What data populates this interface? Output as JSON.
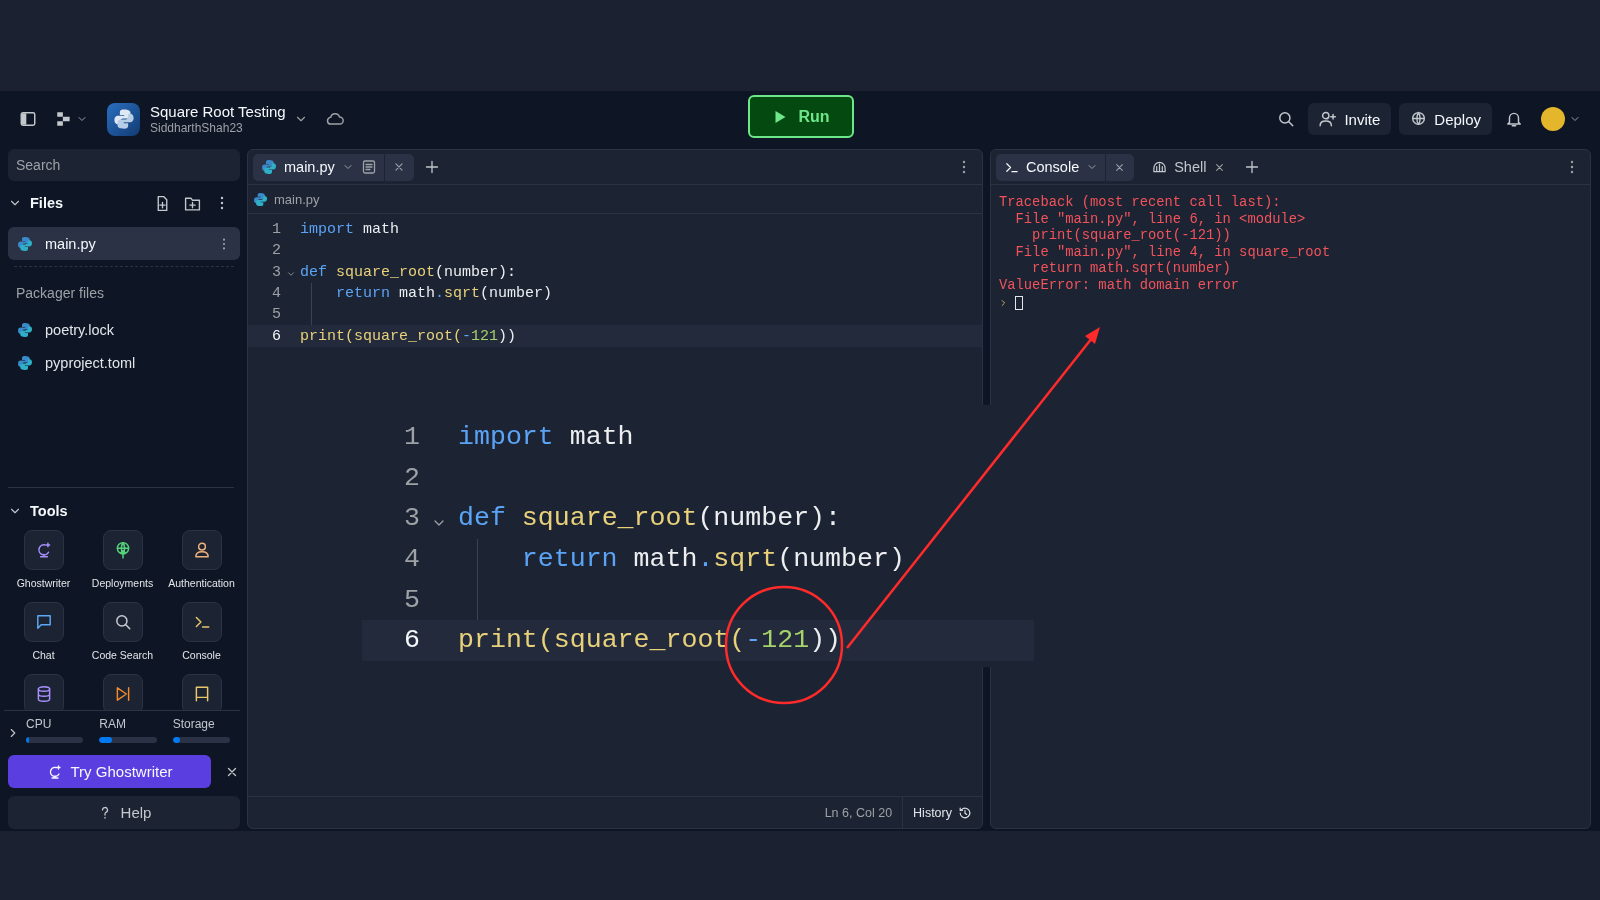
{
  "header": {
    "project_title": "Square Root Testing",
    "owner": "SiddharthShah23",
    "run_label": "Run",
    "invite_label": "Invite",
    "deploy_label": "Deploy"
  },
  "sidebar": {
    "search_placeholder": "Search",
    "files_title": "Files",
    "files_expanded": true,
    "files": [
      {
        "name": "main.py",
        "selected": true
      }
    ],
    "packager_title": "Packager files",
    "packager_files": [
      {
        "name": "poetry.lock"
      },
      {
        "name": "pyproject.toml"
      }
    ],
    "tools_title": "Tools",
    "tools_expanded": true,
    "tools": [
      {
        "label": "Ghostwriter",
        "kind": "sparkle"
      },
      {
        "label": "Deployments",
        "kind": "globe"
      },
      {
        "label": "Authentication",
        "kind": "person"
      },
      {
        "label": "Chat",
        "kind": "chat"
      },
      {
        "label": "Code Search",
        "kind": "search"
      },
      {
        "label": "Console",
        "kind": "prompt"
      },
      {
        "kind": "database"
      },
      {
        "kind": "play"
      },
      {
        "kind": "screen"
      }
    ],
    "resources_expanded": false,
    "resources": [
      {
        "label": "CPU",
        "level": 0.05
      },
      {
        "label": "RAM",
        "level": 0.22
      },
      {
        "label": "Storage",
        "level": 0.12
      }
    ],
    "promo_label": "Try Ghostwriter",
    "help_label": "Help"
  },
  "editor": {
    "tabs": [
      {
        "label": "main.py",
        "selected": true
      }
    ],
    "breadcrumb": "main.py",
    "lines": [
      {
        "number": "1",
        "active": false,
        "foldable": false,
        "indent_guide": false,
        "tokens": [
          {
            "text": "import",
            "kind": "keyword"
          },
          {
            "text": " math",
            "kind": "plain"
          }
        ]
      },
      {
        "number": "2",
        "active": false,
        "foldable": false,
        "indent_guide": false
      },
      {
        "number": "3",
        "active": false,
        "foldable": true,
        "indent_guide": false,
        "tokens": [
          {
            "text": "def",
            "kind": "keyword"
          },
          {
            "text": " square_root",
            "kind": "function"
          },
          {
            "text": "(number):",
            "kind": "plain"
          }
        ]
      },
      {
        "number": "4",
        "active": false,
        "foldable": false,
        "indent_guide": true,
        "tokens": [
          {
            "text": "return",
            "kind": "keyword"
          },
          {
            "text": " math",
            "kind": "plain"
          },
          {
            "text": ".",
            "kind": "operator"
          },
          {
            "text": "sqrt",
            "kind": "function"
          },
          {
            "text": "(number)",
            "kind": "plain"
          }
        ]
      },
      {
        "number": "5",
        "active": false,
        "foldable": false,
        "indent_guide": true
      },
      {
        "number": "6",
        "active": true,
        "foldable": false,
        "indent_guide": false,
        "tokens": [
          {
            "text": "print(square_root(",
            "kind": "function"
          },
          {
            "text": "-",
            "kind": "operator"
          },
          {
            "text": "121",
            "kind": "number"
          },
          {
            "text": "))",
            "kind": "plain"
          }
        ]
      }
    ],
    "cursor_position": "Ln 6, Col 20",
    "history_label": "History"
  },
  "console": {
    "tabs": [
      {
        "label": "Console",
        "kind": "prompt",
        "selected": true
      },
      {
        "label": "Shell",
        "kind": "shell",
        "selected": false
      }
    ],
    "output": [
      "Traceback (most recent call last):",
      "  File \"main.py\", line 6, in <module>",
      "    print(square_root(-121))",
      "  File \"main.py\", line 4, in square_root",
      "    return math.sqrt(number)",
      "ValueError: math domain error"
    ]
  },
  "magnified_code": {
    "lines": [
      {
        "number": "1",
        "active": false,
        "foldable": false,
        "indent_guide": false,
        "tokens": [
          {
            "text": "import",
            "kind": "keyword"
          },
          {
            "text": " math",
            "kind": "plain"
          }
        ]
      },
      {
        "number": "2",
        "active": false,
        "foldable": false,
        "indent_guide": false
      },
      {
        "number": "3",
        "active": false,
        "foldable": true,
        "indent_guide": false,
        "tokens": [
          {
            "text": "def",
            "kind": "keyword"
          },
          {
            "text": " square_root",
            "kind": "function"
          },
          {
            "text": "(number):",
            "kind": "plain"
          }
        ]
      },
      {
        "number": "4",
        "active": false,
        "foldable": false,
        "indent_guide": true,
        "tokens": [
          {
            "text": "return",
            "kind": "keyword"
          },
          {
            "text": " math",
            "kind": "plain"
          },
          {
            "text": ".",
            "kind": "operator"
          },
          {
            "text": "sqrt",
            "kind": "function"
          },
          {
            "text": "(number)",
            "kind": "plain"
          }
        ]
      },
      {
        "number": "5",
        "active": false,
        "foldable": false,
        "indent_guide": true
      },
      {
        "number": "6",
        "active": true,
        "foldable": false,
        "indent_guide": false,
        "tokens": [
          {
            "text": "print(square_root(",
            "kind": "function"
          },
          {
            "text": "-",
            "kind": "operator"
          },
          {
            "text": "121",
            "kind": "number"
          },
          {
            "text": "))",
            "kind": "plain"
          }
        ]
      }
    ]
  }
}
